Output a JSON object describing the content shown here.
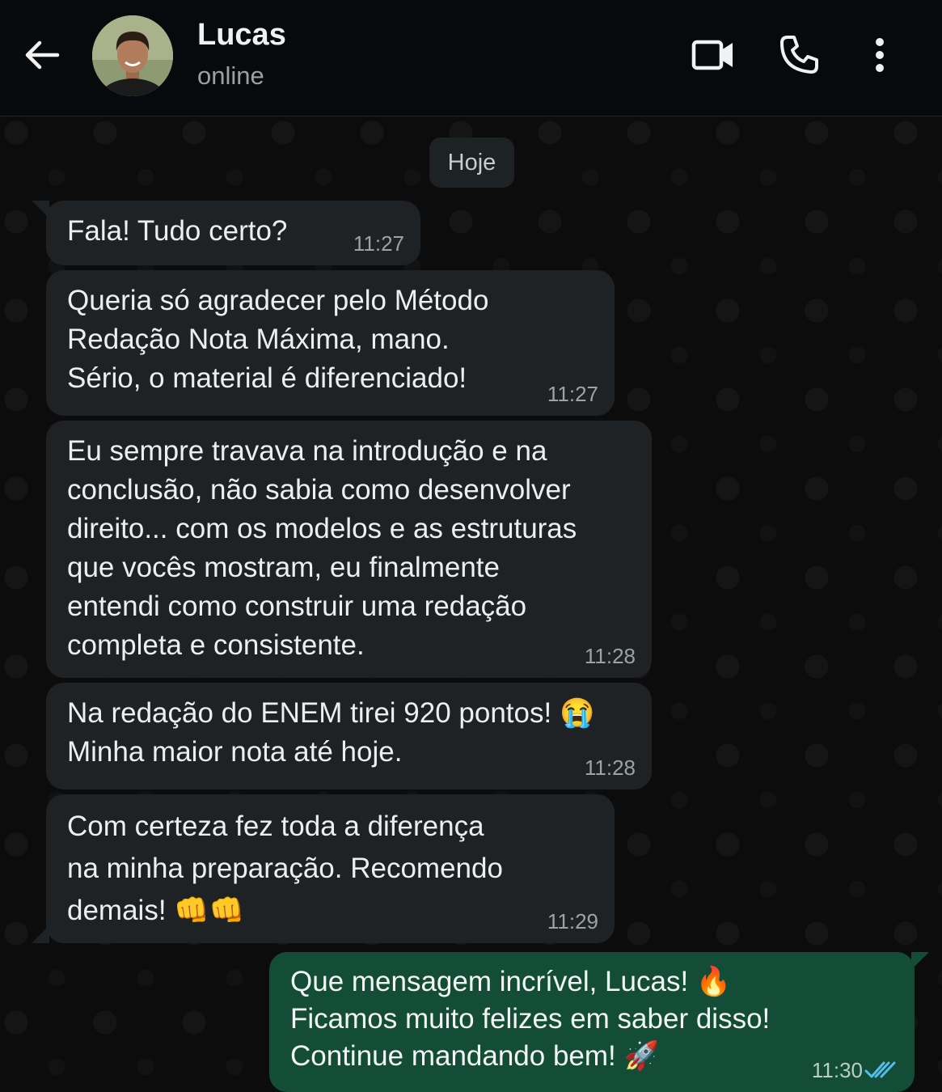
{
  "header": {
    "contact_name": "Lucas",
    "status": "online",
    "icons": {
      "back": "arrow-left-icon",
      "video": "video-camera-icon",
      "call": "phone-icon",
      "menu": "more-vertical-icon"
    }
  },
  "chat": {
    "date_label": "Hoje",
    "messages": [
      {
        "direction": "incoming",
        "text": "Fala! Tudo certo?",
        "time": "11:27"
      },
      {
        "direction": "incoming",
        "text": "Queria só agradecer pelo Método\nRedação Nota Máxima, mano.\nSério, o material é diferenciado!",
        "time": "11:27"
      },
      {
        "direction": "incoming",
        "text": "Eu sempre travava na introdução e na\nconclusão, não sabia como desenvolver\ndireito... com os modelos e as estruturas\nque vocês mostram, eu finalmente\nentendi como construir uma redação\ncompleta e consistente.",
        "time": "11:28"
      },
      {
        "direction": "incoming",
        "text": "Na redação do ENEM tirei 920 pontos! 😭\nMinha maior nota até hoje.",
        "time": "11:28"
      },
      {
        "direction": "incoming",
        "text": "Com certeza fez toda a diferença\nna minha preparação. Recomendo\ndemais! 👊👊",
        "time": "11:29"
      },
      {
        "direction": "outgoing",
        "text": "Que mensagem incrível, Lucas! 🔥\nFicamos muito felizes em saber disso!\nContinue mandando bem! 🚀",
        "time": "11:30",
        "status": "read"
      }
    ]
  },
  "colors": {
    "header_bg": "#070a0c",
    "incoming_bubble": "#1f2225",
    "outgoing_bubble": "#144d37",
    "read_ticks": "#53bdeb"
  }
}
